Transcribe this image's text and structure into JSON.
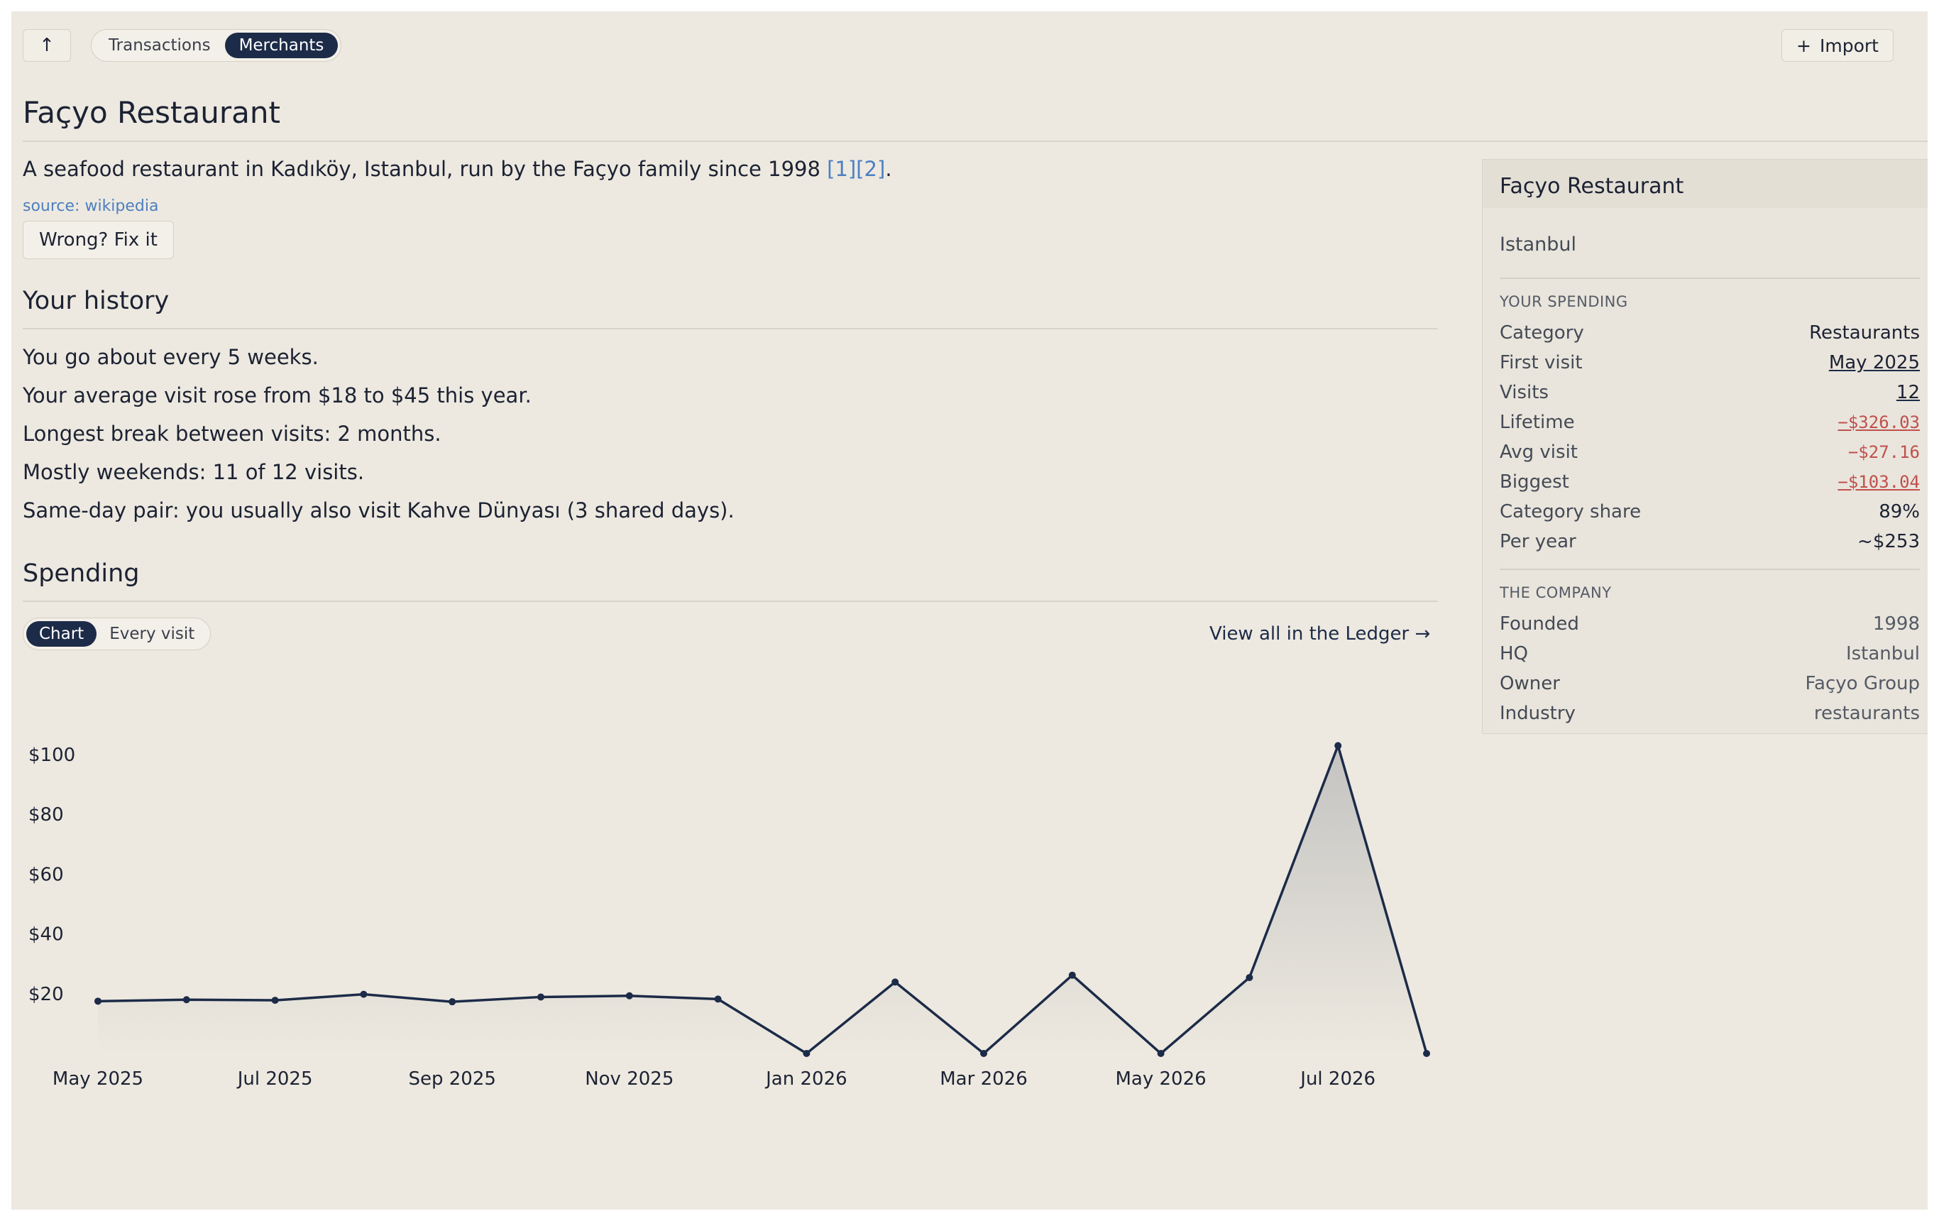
{
  "toolbar": {
    "up_glyph": "↑",
    "tabs": [
      {
        "label": "Transactions",
        "active": false
      },
      {
        "label": "Merchants",
        "active": true
      }
    ],
    "import_label": "Import",
    "import_glyph": "+"
  },
  "merchant": {
    "name": "Façyo Restaurant",
    "description": "A seafood restaurant in Kadıköy, Istanbul, run by the Façyo family since 1998",
    "refs": "[1][2]",
    "source": "source: wikipedia",
    "fix_label": "Wrong? Fix it"
  },
  "history": {
    "heading": "Your history",
    "lines": [
      "You go about every 5 weeks.",
      "Your average visit rose from $18 to $45 this year.",
      "Longest break between visits: 2 months.",
      "Mostly weekends: 11 of 12 visits.",
      "Same-day pair: you usually also visit Kahve Dünyası (3 shared days)."
    ]
  },
  "spending": {
    "heading": "Spending",
    "view_tabs": [
      {
        "label": "Chart",
        "active": true
      },
      {
        "label": "Every visit",
        "active": false
      }
    ],
    "ledger_link": "View all in the Ledger →"
  },
  "chart_data": {
    "type": "area",
    "x": [
      "May 2025",
      "Jun 2025",
      "Jul 2025",
      "Aug 2025",
      "Sep 2025",
      "Oct 2025",
      "Nov 2025",
      "Dec 2025",
      "Jan 2026",
      "Feb 2026",
      "Mar 2026",
      "Apr 2026",
      "May 2026",
      "Jun 2026",
      "Jul 2026",
      "Aug 2026"
    ],
    "values": [
      17.5,
      18,
      17.8,
      19.8,
      17.3,
      18.9,
      19.3,
      18.2,
      0,
      23.9,
      0,
      26.2,
      0,
      25.4,
      103,
      0
    ],
    "x_ticks": [
      "May 2025",
      "Jul 2025",
      "Sep 2025",
      "Nov 2025",
      "Jan 2026",
      "Mar 2026",
      "May 2026",
      "Jul 2026"
    ],
    "y_ticks": [
      "$20",
      "$40",
      "$60",
      "$80",
      "$100"
    ],
    "y_tick_values": [
      20,
      40,
      60,
      80,
      100
    ],
    "ylim": [
      0,
      105
    ],
    "line_color": "#1c2b48",
    "grid": false
  },
  "panel": {
    "title": "Façyo Restaurant",
    "city": "Istanbul",
    "spending_heading": "YOUR SPENDING",
    "spending": [
      {
        "key": "Category",
        "value": "Restaurants"
      },
      {
        "key": "First visit",
        "value": "May 2025"
      },
      {
        "key": "Visits",
        "value": "12"
      },
      {
        "key": "Lifetime",
        "value": "−$326.03"
      },
      {
        "key": "Avg visit",
        "value": "−$27.16"
      },
      {
        "key": "Biggest",
        "value": "−$103.04"
      },
      {
        "key": "Category share",
        "value": "89%"
      },
      {
        "key": "Per year",
        "value": "~$253"
      }
    ],
    "company_heading": "THE COMPANY",
    "company": [
      {
        "key": "Founded",
        "value": "1998"
      },
      {
        "key": "HQ",
        "value": "Istanbul"
      },
      {
        "key": "Owner",
        "value": "Façyo Group"
      },
      {
        "key": "Industry",
        "value": "restaurants"
      }
    ]
  },
  "colors": {
    "background": "#ede9e0",
    "accent": "#1c2b48",
    "negative": "#c0504d",
    "link": "#4d7fc1"
  }
}
